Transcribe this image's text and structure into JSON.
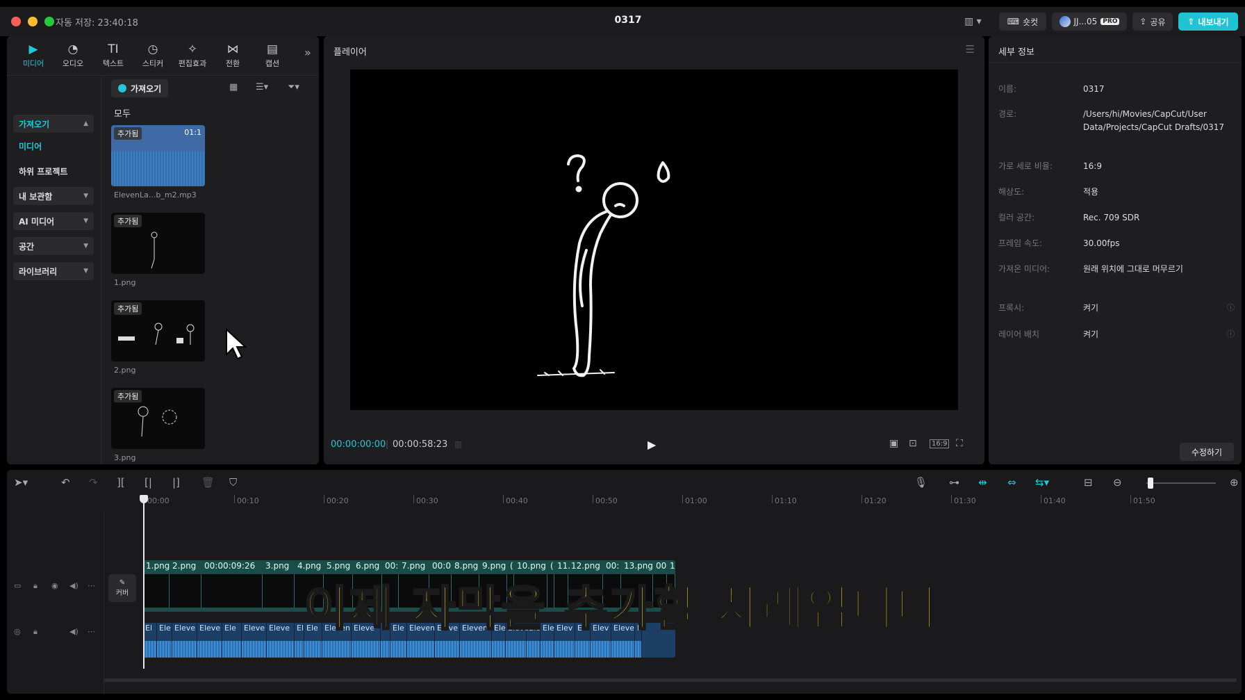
{
  "titlebar": {
    "autosave": "자동 저장: 23:40:18",
    "title": "0317",
    "shortcut_label": "숏컷",
    "user_label": "JJ...05",
    "pro_badge": "PRO",
    "share_label": "공유",
    "export_label": "내보내기"
  },
  "media_toolbar": [
    {
      "label": "미디어",
      "icon": "media-icon"
    },
    {
      "label": "오디오",
      "icon": "audio-icon"
    },
    {
      "label": "텍스트",
      "icon": "text-icon"
    },
    {
      "label": "스티커",
      "icon": "sticker-icon"
    },
    {
      "label": "편집효과",
      "icon": "effects-icon"
    },
    {
      "label": "전환",
      "icon": "transition-icon"
    },
    {
      "label": "캡션",
      "icon": "caption-icon"
    }
  ],
  "side_nav": {
    "import": "가져오기",
    "media": "미디어",
    "subprojects": "하위 프로젝트",
    "my_library": "내 보관함",
    "ai_media": "AI 미디어",
    "space": "공간",
    "library": "라이브러리"
  },
  "media_panel": {
    "import_button": "가져오기",
    "filter_all": "모두",
    "items": [
      {
        "tag": "추가됨",
        "duration": "01:1",
        "name": "ElevenLa...b_m2.mp3"
      },
      {
        "tag": "추가됨",
        "name": "1.png"
      },
      {
        "tag": "추가됨",
        "name": "2.png"
      },
      {
        "tag": "추가됨",
        "name": "3.png"
      }
    ]
  },
  "player": {
    "title": "플레이어",
    "current_time": "00:00:00:00",
    "total_time": "00:00:58:23",
    "aspect": "16:9"
  },
  "details": {
    "title": "세부 정보",
    "rows": [
      {
        "label": "이름:",
        "value": "0317"
      },
      {
        "label": "경로:",
        "value": "/Users/hi/Movies/CapCut/User Data/Projects/CapCut Drafts/0317"
      },
      {
        "label": "가로 세로 비율:",
        "value": "16:9"
      },
      {
        "label": "해상도:",
        "value": "적용"
      },
      {
        "label": "컬러 공간:",
        "value": "Rec. 709 SDR"
      },
      {
        "label": "프레임 속도:",
        "value": "30.00fps"
      },
      {
        "label": "가져온 미디어:",
        "value": "원래 위치에 그대로 머무르기"
      },
      {
        "label": "프록시:",
        "value": "켜기"
      },
      {
        "label": "레이어 배치",
        "value": "켜기"
      }
    ],
    "edit_button": "수정하기"
  },
  "timeline": {
    "ruler": [
      "00:00",
      "00:10",
      "00:20",
      "00:30",
      "00:40",
      "00:50",
      "01:00",
      "01:10",
      "01:20",
      "01:30",
      "01:40",
      "01:50"
    ],
    "cover_label": "커버",
    "video_clips": [
      "1.png",
      "2.png",
      "00:00:09:26",
      "3.png",
      "4.png",
      "5.png",
      "6.png",
      "00:",
      "7.png",
      "00:0",
      "8.png",
      "9.png",
      "(",
      "10.png",
      "(",
      "11.",
      "12.png",
      "00:",
      "13.png",
      "00",
      "1"
    ],
    "audio_clips": [
      "El",
      "Ele",
      "Eleve",
      "Eleve",
      "Ele",
      "Eleve",
      "Eleve",
      "El",
      "Ele",
      "Eleven",
      "Eleve",
      "El",
      "Ele",
      "Eleven",
      "Eleve",
      "Elevenl",
      "Ele",
      "Eleve",
      "Ele",
      "Ele",
      "Elev",
      "Ele",
      "Elev",
      "Eleve",
      "E"
    ]
  },
  "subtitle": "이제 자막을 추가할 차례입니다",
  "colors": {
    "accent": "#22c8d8",
    "subtitle": "#f4ea24",
    "video_track": "#1a4c4a",
    "audio_track": "#1d3f66"
  }
}
